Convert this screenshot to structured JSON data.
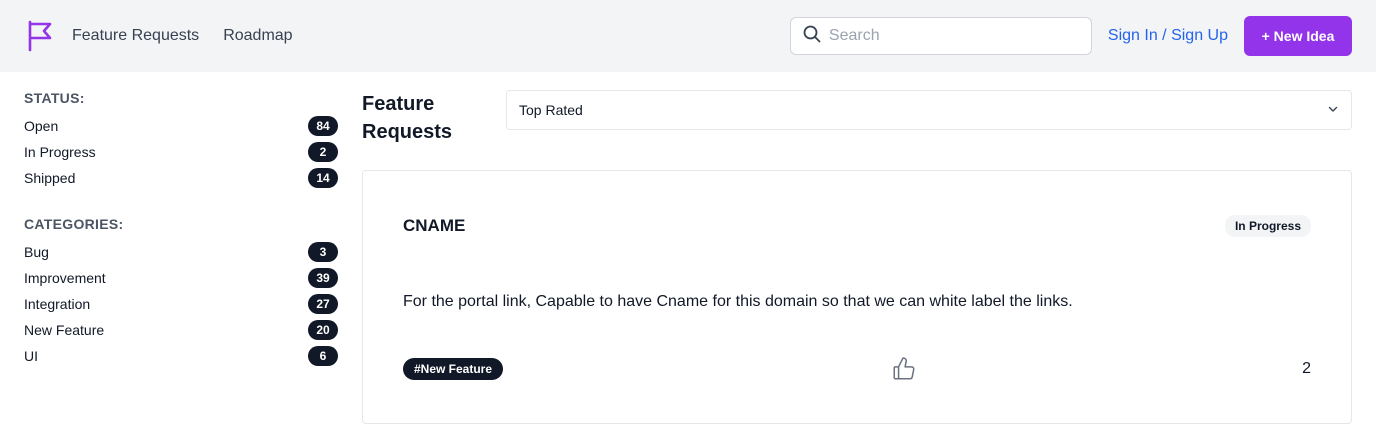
{
  "header": {
    "logo_icon": "flag-icon",
    "brand_color": "#9333ea",
    "nav": [
      "Feature Requests",
      "Roadmap"
    ],
    "search_placeholder": "Search",
    "sign_in": "Sign In / Sign Up",
    "new_idea": "+ New Idea"
  },
  "sidebar": {
    "status_heading": "STATUS:",
    "status": [
      {
        "label": "Open",
        "count": "84"
      },
      {
        "label": "In Progress",
        "count": "2"
      },
      {
        "label": "Shipped",
        "count": "14"
      }
    ],
    "categories_heading": "CATEGORIES:",
    "categories": [
      {
        "label": "Bug",
        "count": "3"
      },
      {
        "label": "Improvement",
        "count": "39"
      },
      {
        "label": "Integration",
        "count": "27"
      },
      {
        "label": "New Feature",
        "count": "20"
      },
      {
        "label": "UI",
        "count": "6"
      }
    ]
  },
  "main": {
    "title": "Feature Requests",
    "sort_selected": "Top Rated",
    "cards": [
      {
        "title": "CNAME",
        "status": "In Progress",
        "description": "For the portal link, Capable to have Cname for this domain so that we can white label the links.",
        "tag": "#New Feature",
        "votes": "2"
      }
    ]
  }
}
